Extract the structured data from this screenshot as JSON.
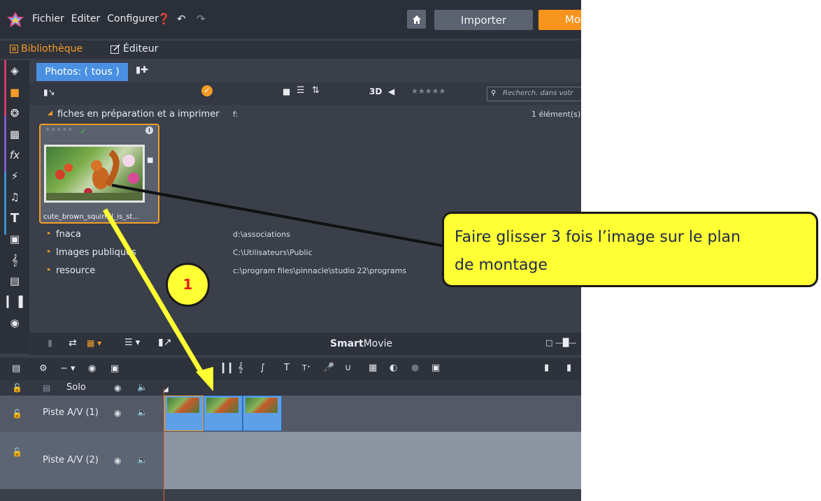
{
  "menu": {
    "file": "Fichier",
    "edit": "Editer",
    "configure": "Configurer"
  },
  "top_buttons": {
    "import": "Importer",
    "mode": "Mo"
  },
  "modes": {
    "library": "Bibliothèque",
    "editor": "Éditeur"
  },
  "library": {
    "tab": "Photos: ( tous )",
    "view_3d": "3D",
    "search_placeholder": "Recherch. dans votr",
    "count": "1 élément(s)",
    "folders": [
      {
        "name": "fiches en préparation et a imprimer",
        "path": "f:",
        "expanded": true
      },
      {
        "name": "fnaca",
        "path": "d:\\associations",
        "expanded": false
      },
      {
        "name": "Images publiques",
        "path": "C:\\Utilisateurs\\Public",
        "expanded": false
      },
      {
        "name": "resource",
        "path": "c:\\program files\\pinnacle\\studio 22\\programs",
        "expanded": false
      }
    ],
    "thumbnail": {
      "caption": "cute_brown_squirrel_is_st..."
    },
    "smartmovie_bold": "Smart",
    "smartmovie_rest": "Movie"
  },
  "timeline": {
    "tracks": [
      {
        "label": "Solo"
      },
      {
        "label": "Piste A/V (1)"
      },
      {
        "label": "Piste A/V (2)"
      }
    ]
  },
  "annotations": {
    "callout_line1": "Faire glisser 3 fois l’image sur le plan",
    "callout_line2": "de montage",
    "step_number": "1"
  },
  "colors": {
    "accent_orange": "#f39c27",
    "tab_blue": "#4a90e2",
    "annotation_yellow": "#ffff33"
  }
}
